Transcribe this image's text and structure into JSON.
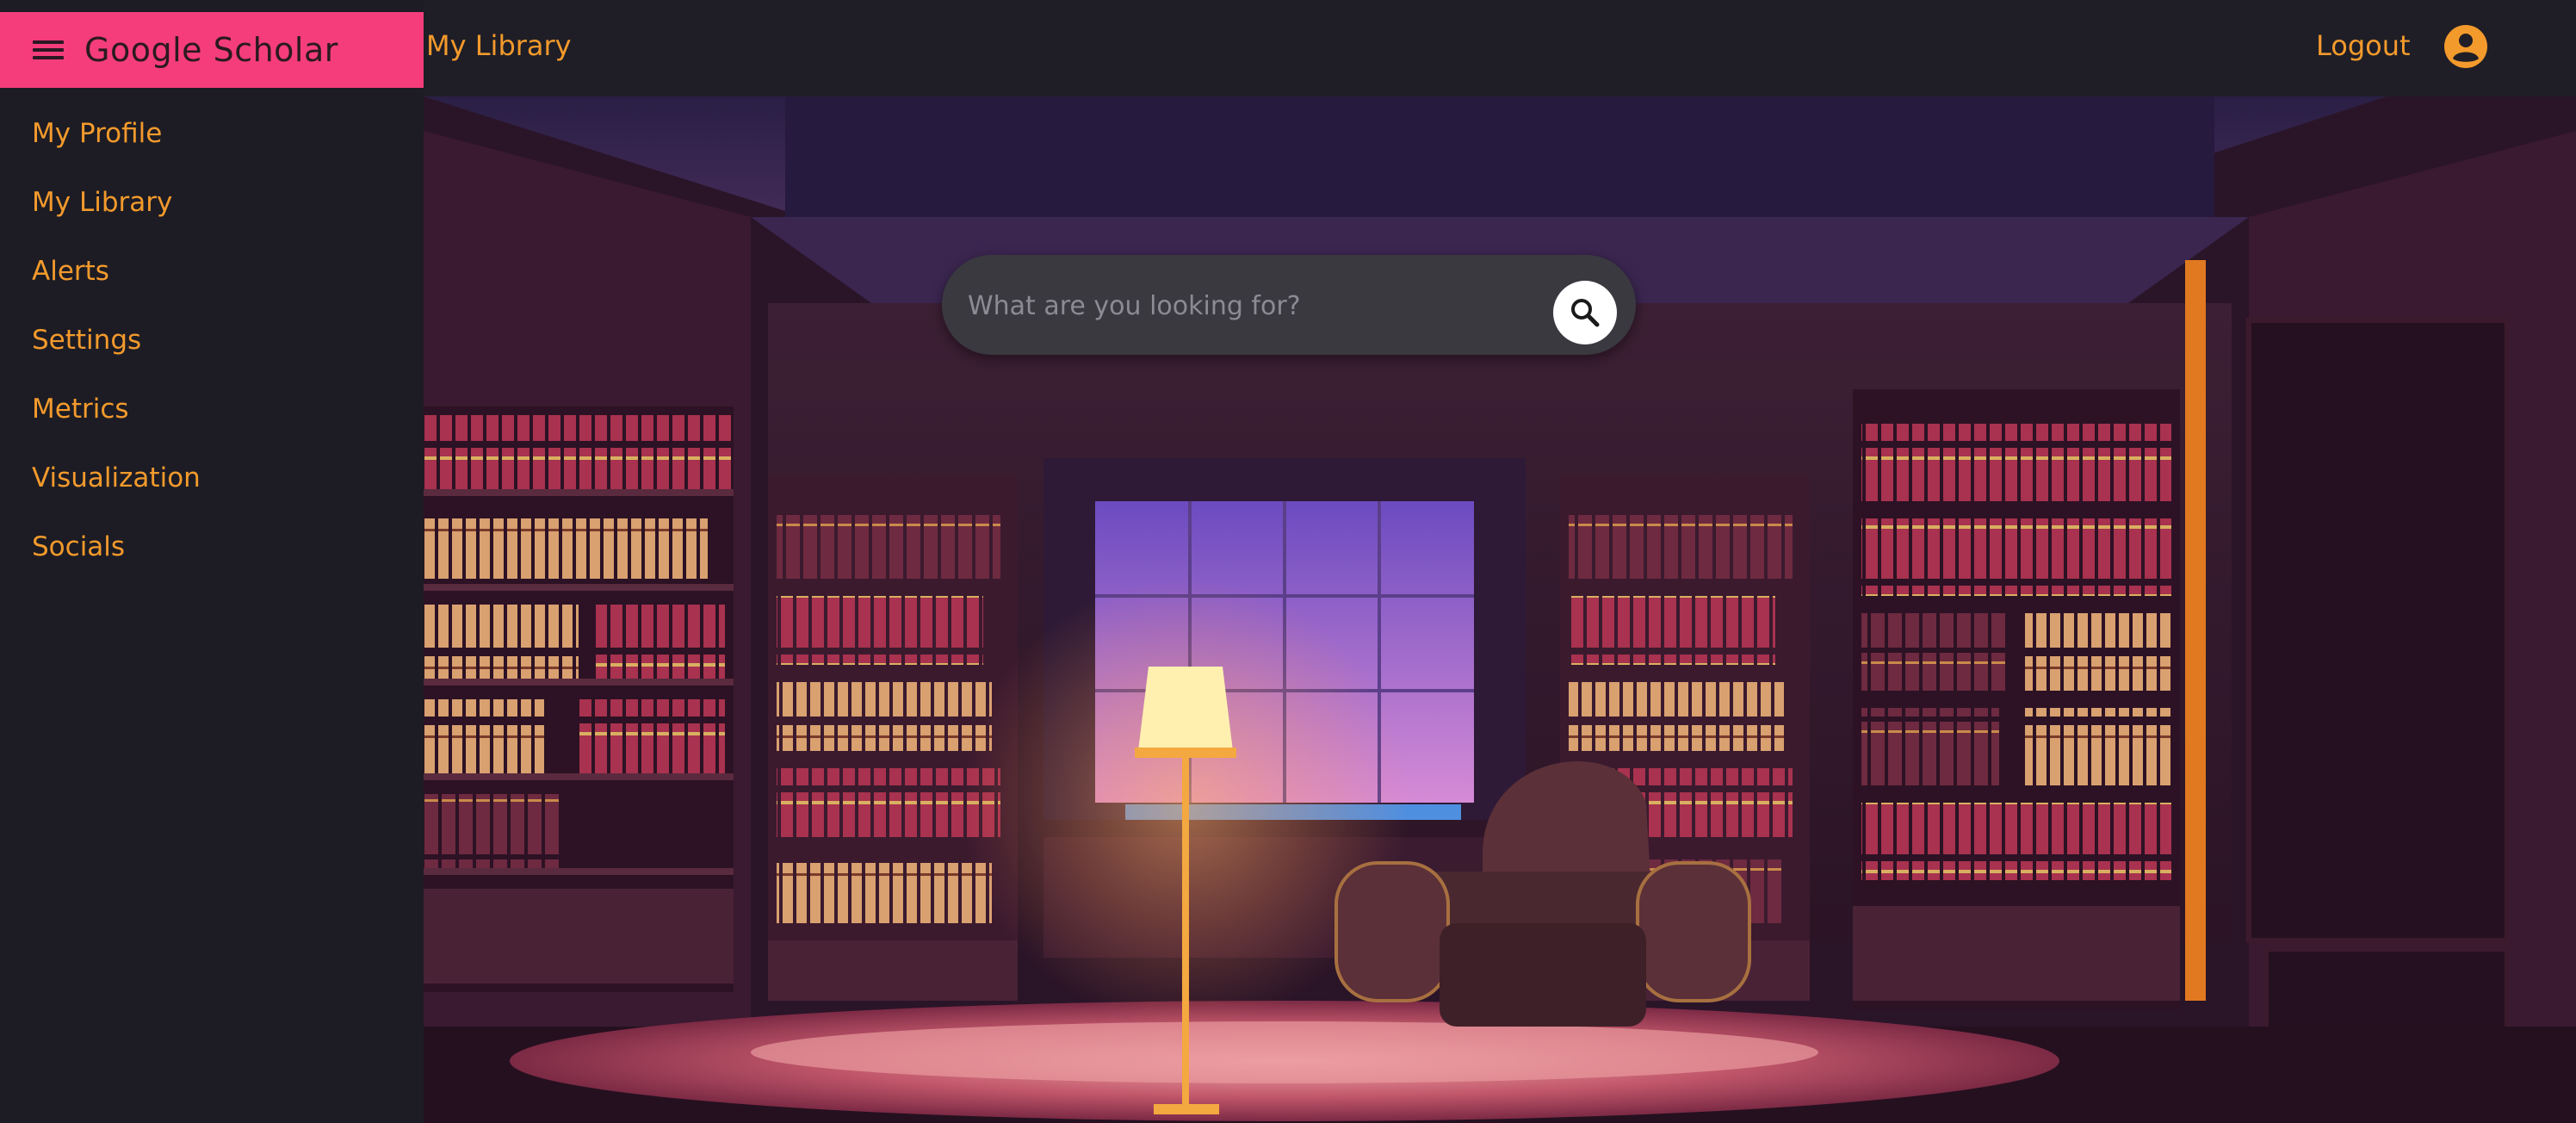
{
  "app": {
    "title": "Google Scholar"
  },
  "sidebar": {
    "items": [
      {
        "label": "My Profile"
      },
      {
        "label": "My Library"
      },
      {
        "label": "Alerts"
      },
      {
        "label": "Settings"
      },
      {
        "label": "Metrics"
      },
      {
        "label": "Visualization"
      },
      {
        "label": "Socials"
      }
    ]
  },
  "header": {
    "title": "My Library",
    "logout_label": "Logout",
    "account_icon": "account-circle-icon"
  },
  "search": {
    "placeholder": "What are you looking for?",
    "button_icon": "search-icon"
  },
  "colors": {
    "brand": "#f53d7c",
    "accent_text": "#f39a2c",
    "sidebar_bg": "#1d1c24",
    "topbar_bg": "#1f1e26"
  }
}
